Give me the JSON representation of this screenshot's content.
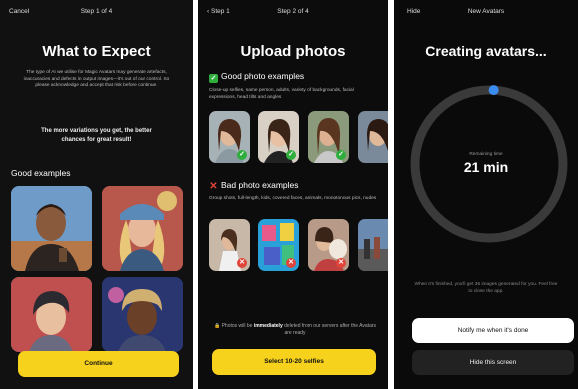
{
  "screen1": {
    "cancel": "Cancel",
    "step": "Step 1 of 4",
    "title": "What to Expect",
    "body": "The type of AI we utilise for Magic Avatars may generate artefacts, inaccuracies and defects in output images—it's out of our control. So please acknowledge and accept that risk before continue.",
    "tip_line1": "The more variations you get, the better",
    "tip_line2": "chances for great result!",
    "examples_label": "Good examples",
    "continue": "Continue"
  },
  "screen2": {
    "back": "Step 1",
    "step": "Step 2 of 4",
    "title": "Upload photos",
    "good_label": "Good photo examples",
    "good_desc": "Close-up selfies, same person, adults, variety of backgrounds, facial expressions, head tilts and angles",
    "bad_label": "Bad photo examples",
    "bad_desc": "Group shots, full-length, kids, covered faces, animals, monotonous pics, nudes",
    "privacy_pre": "Photos will be ",
    "privacy_bold": "immediately",
    "privacy_post": " deleted from our servers after the Avatars are ready",
    "select_button": "Select 10-20 selfies"
  },
  "screen3": {
    "hide": "Hide",
    "title": "New Avatars",
    "heading": "Creating avatars...",
    "remaining_label": "Remaining time",
    "remaining_value": "21 min",
    "progress_fraction": 0.01,
    "note": "When it's finished, you'll get 36 images generated for you. Feel free to close the app.",
    "notify_button": "Notify me when it's done",
    "hide_button": "Hide this screen"
  },
  "colors": {
    "accent_yellow": "#f6d21c",
    "ok_green": "#2fae3d",
    "bad_red": "#e0443a",
    "progress_blue": "#3b8cf0"
  }
}
